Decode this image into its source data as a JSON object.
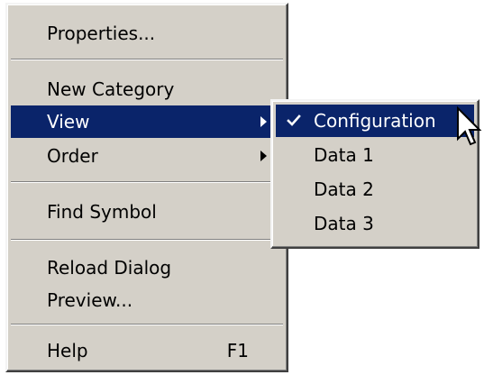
{
  "main_menu": {
    "items": [
      {
        "label": "Properties..."
      },
      {
        "label": "New Category"
      },
      {
        "label": "View"
      },
      {
        "label": "Order"
      },
      {
        "label": "Find Symbol"
      },
      {
        "label": "Reload Dialog"
      },
      {
        "label": "Preview..."
      },
      {
        "label": "Help",
        "shortcut": "F1"
      }
    ]
  },
  "view_submenu": {
    "items": [
      {
        "label": "Configuration",
        "checked": true
      },
      {
        "label": "Data 1"
      },
      {
        "label": "Data 2"
      },
      {
        "label": "Data 3"
      }
    ]
  },
  "colors": {
    "menu_background": "#d4d0c8",
    "highlight": "#0a246a",
    "highlight_text": "#ffffff"
  },
  "icons": [
    "chevron-right-icon",
    "checkmark-icon",
    "mouse-pointer-icon"
  ]
}
